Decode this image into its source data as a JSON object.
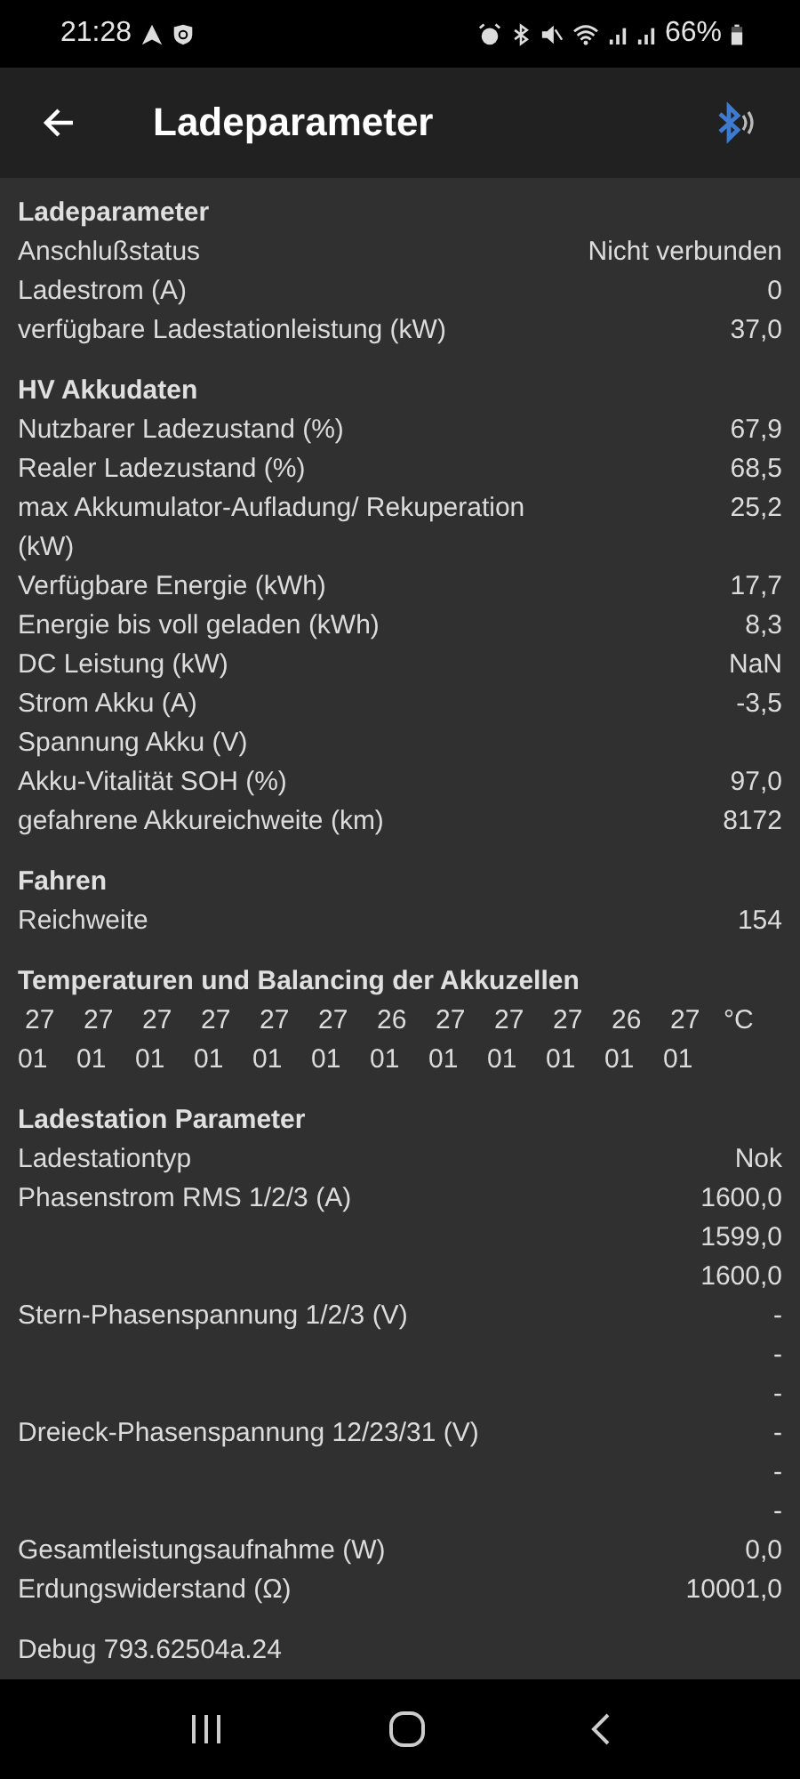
{
  "status_bar": {
    "time": "21:28",
    "battery": "66%"
  },
  "app_bar": {
    "title": "Ladeparameter"
  },
  "sections": [
    {
      "title": "Ladeparameter",
      "rows": [
        {
          "label": "Anschlußstatus",
          "values": [
            "Nicht verbunden"
          ]
        },
        {
          "label": "Ladestrom (A)",
          "values": [
            "0"
          ]
        },
        {
          "label": "verfügbare Ladestationleistung (kW)",
          "values": [
            "37,0"
          ]
        }
      ]
    },
    {
      "title": "HV Akkudaten",
      "rows": [
        {
          "label": "Nutzbarer Ladezustand (%)",
          "values": [
            "67,9"
          ]
        },
        {
          "label": "Realer Ladezustand (%)",
          "values": [
            "68,5"
          ]
        },
        {
          "label": "max Akkumulator-Aufladung/ Rekuperation (kW)",
          "values": [
            "25,2"
          ]
        },
        {
          "label": "Verfügbare Energie (kWh)",
          "values": [
            "17,7"
          ]
        },
        {
          "label": "Energie bis voll geladen (kWh)",
          "values": [
            "8,3"
          ]
        },
        {
          "label": "DC Leistung (kW)",
          "values": [
            "NaN"
          ]
        },
        {
          "label": "Strom Akku (A)",
          "values": [
            "-3,5"
          ]
        },
        {
          "label": "Spannung Akku (V)",
          "values": []
        },
        {
          "label": "Akku-Vitalität SOH (%)",
          "values": [
            "97,0"
          ]
        },
        {
          "label": "gefahrene Akkureichweite (km)",
          "values": [
            "8172"
          ]
        }
      ]
    },
    {
      "title": "Fahren",
      "rows": [
        {
          "label": "Reichweite",
          "values": [
            "154"
          ]
        }
      ]
    },
    {
      "title": "Temperaturen und Balancing der Akkuzellen",
      "cells": {
        "temperatures": [
          "27",
          "27",
          "27",
          "27",
          "27",
          "27",
          "26",
          "27",
          "27",
          "27",
          "26",
          "27"
        ],
        "unit": "°C",
        "balancing": [
          "01",
          "01",
          "01",
          "01",
          "01",
          "01",
          "01",
          "01",
          "01",
          "01",
          "01",
          "01"
        ]
      }
    },
    {
      "title": "Ladestation Parameter",
      "rows": [
        {
          "label": "Ladestationtyp",
          "values": [
            "Nok"
          ]
        },
        {
          "label": "Phasenstrom RMS 1/2/3 (A)",
          "values": [
            "1600,0",
            "1599,0",
            "1600,0"
          ]
        },
        {
          "label": "Stern-Phasenspannung 1/2/3 (V)",
          "values": [
            "-",
            "-",
            "-"
          ]
        },
        {
          "label": "Dreieck-Phasenspannung 12/23/31 (V)",
          "values": [
            "-",
            "-",
            "-"
          ]
        },
        {
          "label": "Gesamtleistungsaufnahme (W)",
          "values": [
            "0,0"
          ]
        },
        {
          "label": "Erdungswiderstand (Ω)",
          "values": [
            "10001,0"
          ]
        }
      ]
    }
  ],
  "debug": "Debug 793.62504a.24"
}
